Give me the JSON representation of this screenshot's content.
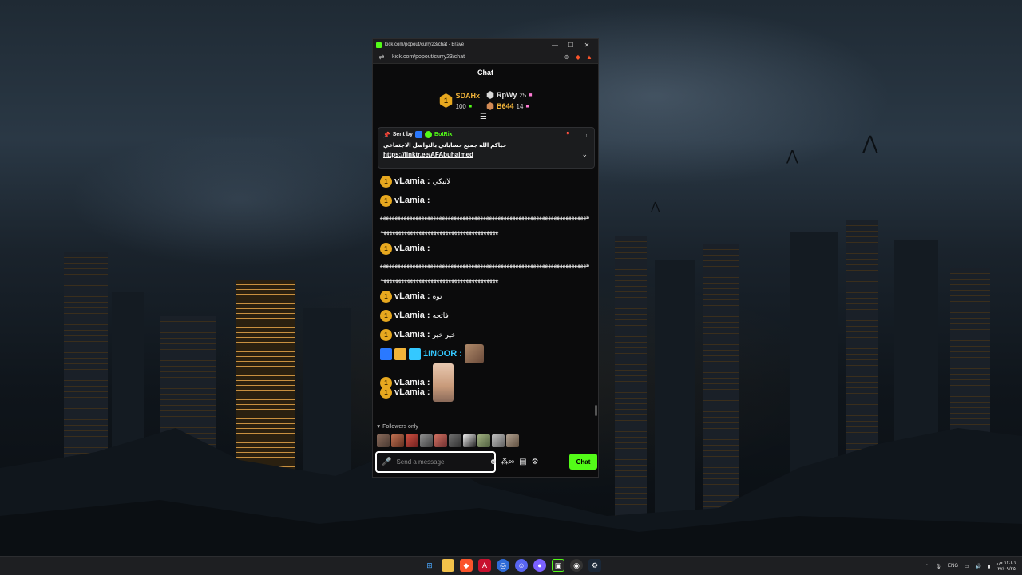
{
  "window": {
    "title": "kick.com/popout/curry23/chat - Brave",
    "url": "kick.com/popout/curry23/chat",
    "controls": {
      "minimize": "—",
      "maximize": "☐",
      "close": "✕"
    }
  },
  "chat": {
    "header": "Chat",
    "leaderboard": {
      "first": {
        "rank": "1",
        "name": "SDAHx",
        "count": "100",
        "name_color": "#f2b43a"
      },
      "second": {
        "name": "RpWy",
        "count": "25",
        "name_color": "#e8e8e8"
      },
      "third": {
        "name": "B644",
        "count": "14",
        "name_color": "#f2b43a"
      }
    },
    "pinned": {
      "sent_by_label": "Sent by",
      "sender": "BotRix",
      "message": "حياكم الله جميع حساباتي بالتواصل الاجتماعي",
      "link": "https://linktr.ee/AFAbuhaimed"
    },
    "messages": [
      {
        "user": "vLamia",
        "text": "لاتبكي"
      },
      {
        "user": "vLamia",
        "text": "ههههههههههههههههههههههههههههههههههههههههههههههههههههههههههههههههههههههههههههههههههههههههههههههههههههههههههههههه"
      },
      {
        "user": "vLamia",
        "text": "ههههههههههههههههههههههههههههههههههههههههههههههههههههههههههههههههههههههههههههههههههههههههههههههههههههههههههههههه"
      },
      {
        "user": "vLamia",
        "text": "توه"
      },
      {
        "user": "vLamia",
        "text": "فاتحه"
      },
      {
        "user": "vLamia",
        "text": "خير خير"
      },
      {
        "user": "1INOOR",
        "text": ""
      },
      {
        "user": "vLamia",
        "text": ""
      },
      {
        "user": "vLamia",
        "text": ""
      }
    ],
    "user_separator": ":",
    "followers_only": "Followers only",
    "input_placeholder": "Send a message",
    "chat_button": "Chat"
  },
  "taskbar": {
    "language": "ENG",
    "time": "١٢:٤٦ ص",
    "date": "٢٧/٠٩/٢٥"
  },
  "colors": {
    "kick_green": "#53fc18",
    "accent_cyan": "#34c8ff",
    "gold": "#e7a81f"
  }
}
